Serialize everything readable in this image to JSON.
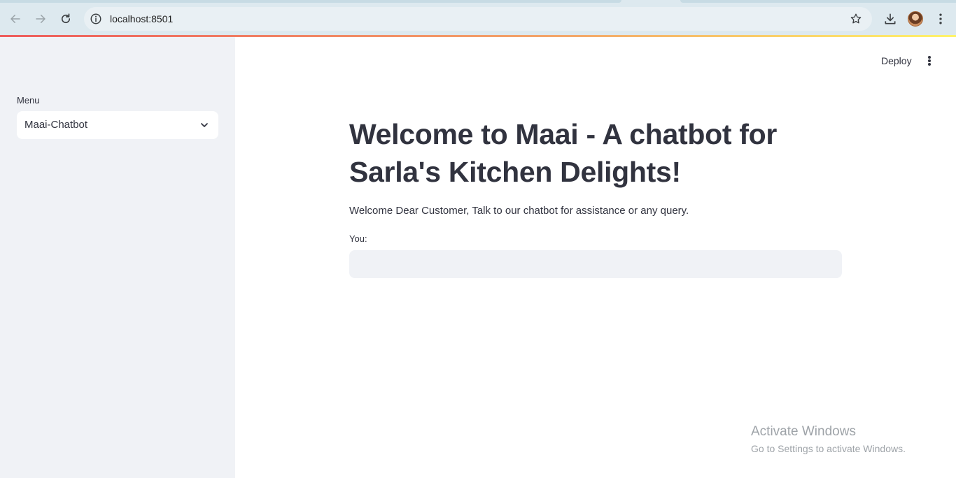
{
  "browser": {
    "url": "localhost:8501",
    "icons": [
      "back-arrow-icon",
      "forward-arrow-icon",
      "reload-icon",
      "site-info-icon",
      "bookmark-star-icon",
      "download-icon",
      "profile-avatar",
      "browser-menu-icon"
    ]
  },
  "sidebar": {
    "menu_label": "Menu",
    "select_value": "Maai-Chatbot"
  },
  "header": {
    "deploy_label": "Deploy"
  },
  "main": {
    "title": "Welcome to Maai - A chatbot for Sarla's Kitchen Delights!",
    "subtitle": "Welcome Dear Customer, Talk to our chatbot for assistance or any query.",
    "input_label": "You:",
    "input_value": ""
  },
  "watermark": {
    "line1": "Activate Windows",
    "line2": "Go to Settings to activate Windows."
  },
  "colors": {
    "sidebar_bg": "#f0f2f6",
    "text": "#31333f",
    "browser_bar": "#dde9ef"
  }
}
